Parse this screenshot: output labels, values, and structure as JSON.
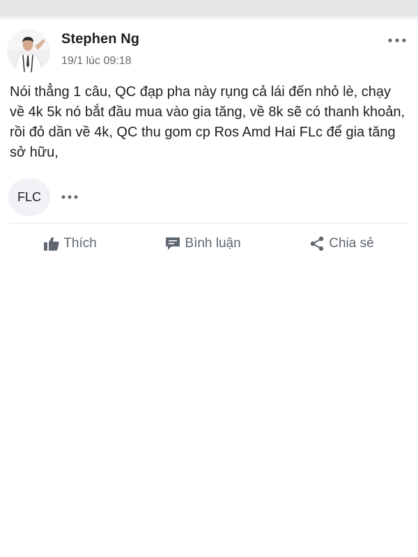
{
  "post": {
    "author": "Stephen Ng",
    "timestamp": "19/1 lúc 09:18",
    "text": "Nói thẳng 1 câu, QC đạp pha này rụng cả lái đến nhỏ lè, chạy về 4k 5k nó bắt đầu mua vào gia tăng, về 8k sẽ có thanh khoản, rồi đỏ dần về 4k, QC thu gom cp Ros Amd Hai FLc để gia tăng sở hữu,",
    "tag": "FLC"
  },
  "actions": {
    "like_label": "Thích",
    "comment_label": "Bình luận",
    "share_label": "Chia sẻ"
  },
  "icons": {
    "more": "more-horizontal-icon",
    "like": "thumbs-up-icon",
    "comment": "comment-icon",
    "share": "share-icon",
    "avatar": "profile-photo"
  },
  "colors": {
    "text": "#1c1e21",
    "secondary_text": "#65676b",
    "action_text": "#606770",
    "chip_bg": "#f0f2f5",
    "divider": "#e6e7ea"
  }
}
